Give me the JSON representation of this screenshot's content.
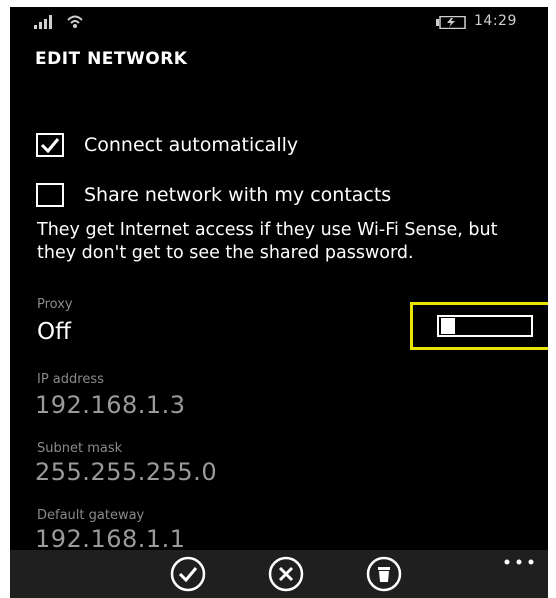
{
  "status_bar": {
    "time": "14:29",
    "icons": [
      "signal-icon",
      "wifi-icon",
      "battery-icon"
    ]
  },
  "page": {
    "title": "EDIT NETWORK"
  },
  "settings": {
    "connect_automatically": {
      "label": "Connect automatically",
      "checked": true
    },
    "share_network": {
      "label": "Share network with my contacts",
      "checked": false
    },
    "share_description": "They get Internet access if they use Wi-Fi Sense, but they don't get to see the shared password.",
    "proxy": {
      "label": "Proxy",
      "value": "Off",
      "toggle_on": false
    },
    "ip_address": {
      "label": "IP address",
      "value": "192.168.1.3"
    },
    "subnet_mask": {
      "label": "Subnet mask",
      "value": "255.255.255.0"
    },
    "default_gateway": {
      "label": "Default gateway",
      "value": "192.168.1.1"
    }
  },
  "app_bar": {
    "buttons": [
      "check-icon",
      "cancel-icon",
      "delete-icon"
    ],
    "more": "more-icon"
  },
  "colors": {
    "background": "#000000",
    "text": "#ffffff",
    "secondary_text": "#8a8a8a",
    "highlight": "#e8e400",
    "app_bar": "#1f1f1f"
  }
}
